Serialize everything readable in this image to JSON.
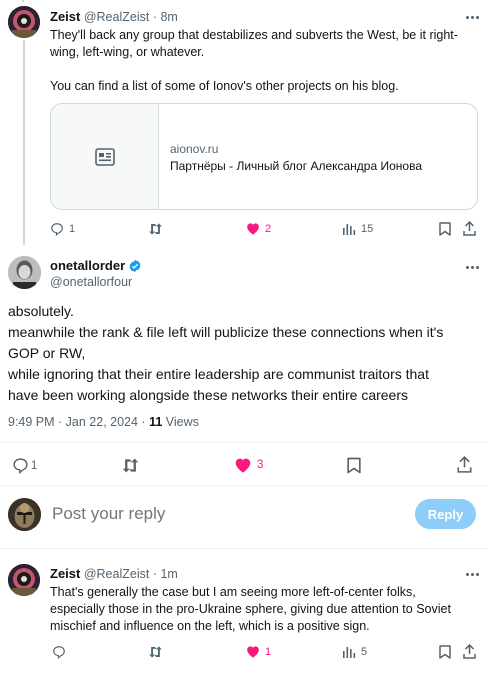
{
  "tweet1": {
    "display_name": "Zeist",
    "handle": "@RealZeist",
    "time": "8m",
    "text_line1": "They'll back any group that destabilizes and subverts the West, be it right-",
    "text_line2": "wing, left-wing, or whatever.",
    "text_line3": "You can find a list of some of Ionov's other projects on his blog.",
    "card": {
      "domain": "aionov.ru",
      "title": "Партнёры - Личный блог Александра Ионова"
    },
    "replies": "1",
    "likes": "2",
    "views": "15"
  },
  "main_tweet": {
    "display_name": "onetallorder",
    "handle": "@onetallorfour",
    "verified": true,
    "line1": "absolutely.",
    "line2": "meanwhile the rank & file left will publicize these connections when it's",
    "line3": "GOP or RW,",
    "line4": "while ignoring that their entire leadership are communist traitors that",
    "line5": "have been working alongside these networks their entire careers",
    "timestamp": "9:49 PM · Jan 22, 2024 · ",
    "views_count": "11",
    "views_label": " Views",
    "replies": "1",
    "likes": "3"
  },
  "reply_box": {
    "placeholder": "Post your reply",
    "button_label": "Reply"
  },
  "tweet2": {
    "display_name": "Zeist",
    "handle": "@RealZeist",
    "time": "1m",
    "line1": "That's generally the case but I am seeing more left-of-center folks,",
    "line2": "especially those in the pro-Ukraine sphere, giving due attention to Soviet",
    "line3": "mischief and influence on the left, which is a positive sign.",
    "likes": "1",
    "views": "5"
  },
  "colors": {
    "like_pink": "#f91880",
    "verified_blue": "#1d9bf0",
    "reply_button_disabled": "#8ecdf8",
    "muted_text": "#536471"
  },
  "icons": [
    "reply-icon",
    "retweet-icon",
    "heart-icon",
    "views-icon",
    "bookmark-icon",
    "share-icon",
    "article-icon",
    "verified-badge-icon",
    "more-icon"
  ]
}
